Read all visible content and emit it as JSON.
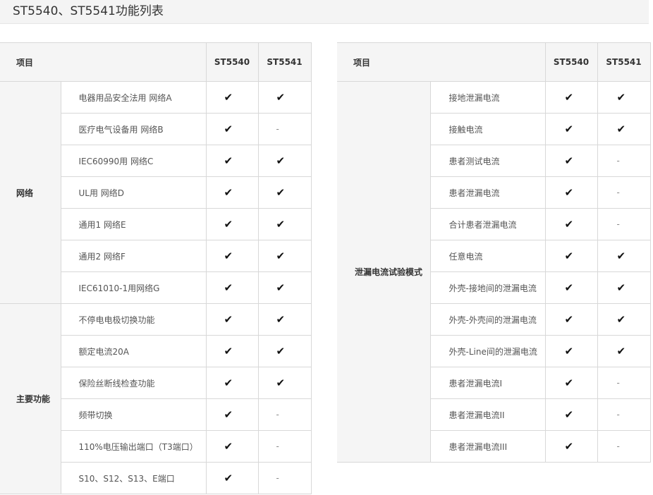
{
  "page": {
    "title": "ST5540、ST5541功能列表"
  },
  "left_table": {
    "headers": {
      "item": "项目",
      "model_a": "ST5540",
      "model_b": "ST5541"
    },
    "groups": [
      {
        "name": "网络",
        "rows": [
          {
            "feature": "电器用品安全法用 网络A",
            "a": "✔",
            "b": "✔"
          },
          {
            "feature": "医疗电气设备用 网络B",
            "a": "✔",
            "b": "-"
          },
          {
            "feature": "IEC60990用 网络C",
            "a": "✔",
            "b": "✔"
          },
          {
            "feature": "UL用 网络D",
            "a": "✔",
            "b": "✔"
          },
          {
            "feature": "通用1 网络E",
            "a": "✔",
            "b": "✔"
          },
          {
            "feature": "通用2 网络F",
            "a": "✔",
            "b": "✔"
          },
          {
            "feature": "IEC61010-1用网络G",
            "a": "✔",
            "b": "✔"
          }
        ]
      },
      {
        "name": "主要功能",
        "rows": [
          {
            "feature": "不停电电极切换功能",
            "a": "✔",
            "b": "✔"
          },
          {
            "feature": "额定电流20A",
            "a": "✔",
            "b": "✔"
          },
          {
            "feature": "保险丝断线检查功能",
            "a": "✔",
            "b": "✔"
          },
          {
            "feature": "频带切换",
            "a": "✔",
            "b": "-"
          },
          {
            "feature": "110%电压输出端口（T3端口）",
            "a": "✔",
            "b": "-"
          },
          {
            "feature": "S10、S12、S13、E端口",
            "a": "✔",
            "b": "-"
          }
        ]
      }
    ]
  },
  "right_table": {
    "headers": {
      "item": "项目",
      "model_a": "ST5540",
      "model_b": "ST5541"
    },
    "groups": [
      {
        "name": "泄漏电流试验模式",
        "rows": [
          {
            "feature": "接地泄漏电流",
            "a": "✔",
            "b": "✔"
          },
          {
            "feature": "接触电流",
            "a": "✔",
            "b": "✔"
          },
          {
            "feature": "患者测试电流",
            "a": "✔",
            "b": "-"
          },
          {
            "feature": "患者泄漏电流",
            "a": "✔",
            "b": "-"
          },
          {
            "feature": "合计患者泄漏电流",
            "a": "✔",
            "b": "-"
          },
          {
            "feature": "任意电流",
            "a": "✔",
            "b": "✔"
          },
          {
            "feature": "外壳-接地间的泄漏电流",
            "a": "✔",
            "b": "✔"
          },
          {
            "feature": "外壳-外壳间的泄漏电流",
            "a": "✔",
            "b": "✔"
          },
          {
            "feature": "外壳-Line间的泄漏电流",
            "a": "✔",
            "b": "✔"
          },
          {
            "feature": "患者泄漏电流Ⅰ",
            "a": "✔",
            "b": "-"
          },
          {
            "feature": "患者泄漏电流ⅠⅠ",
            "a": "✔",
            "b": "-"
          },
          {
            "feature": "患者泄漏电流ⅠⅠⅠ",
            "a": "✔",
            "b": "-"
          }
        ]
      }
    ]
  },
  "icons": {
    "check": "check-mark-icon",
    "none": "dash"
  },
  "colors": {
    "header_bg": "#f5f5f5",
    "border": "#d8d8d8",
    "title_bg": "#f4f4f4"
  }
}
